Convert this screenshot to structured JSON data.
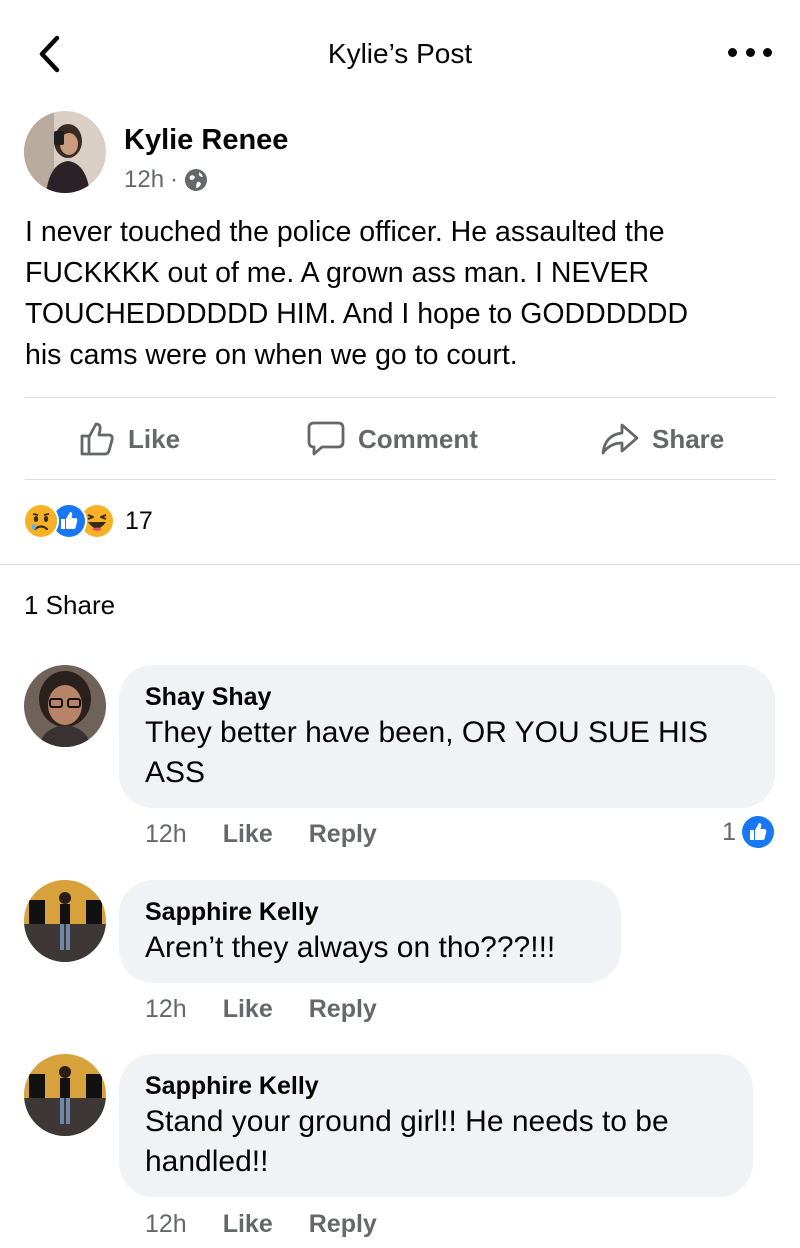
{
  "header": {
    "title": "Kylie’s Post",
    "back_icon": "chevron-left-icon",
    "more_icon": "more-horizontal-icon"
  },
  "post": {
    "author": "Kylie Renee",
    "time": "12h",
    "separator": "·",
    "privacy_icon": "globe-icon",
    "text_lines": [
      "I never touched the police officer. He assaulted the",
      "FUCKKKK out of me. A grown ass man. I NEVER",
      "TOUCHEDDDDDD HIM. And I hope to GODDDDDD",
      "his cams were on when we go to court."
    ]
  },
  "actions": {
    "like_label": "Like",
    "comment_label": "Comment",
    "share_label": "Share"
  },
  "reactions": {
    "count": "17",
    "types": [
      "sad",
      "like",
      "haha"
    ]
  },
  "shares": {
    "label": "1 Share"
  },
  "comments": [
    {
      "name": "Shay Shay",
      "text_lines": [
        "They better have been, OR YOU SUE HIS",
        "ASS"
      ],
      "time": "12h",
      "like_label": "Like",
      "reply_label": "Reply",
      "reaction_count": "1"
    },
    {
      "name": "Sapphire Kelly",
      "text_lines": [
        "Aren’t they always on tho???!!!"
      ],
      "time": "12h",
      "like_label": "Like",
      "reply_label": "Reply"
    },
    {
      "name": "Sapphire Kelly",
      "text_lines": [
        "Stand your ground girl!! He needs to be",
        "handled!!"
      ],
      "time": "12h",
      "like_label": "Like",
      "reply_label": "Reply"
    }
  ],
  "colors": {
    "text_primary": "#050505",
    "text_secondary": "#65676b",
    "bubble_bg": "#f0f2f5",
    "divider": "#dadde1",
    "facebook_blue": "#1877f2",
    "reaction_yellow": "#f7b125"
  }
}
